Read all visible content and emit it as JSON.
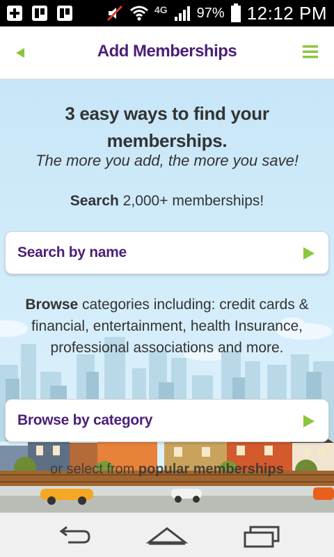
{
  "status_bar": {
    "network": "4G",
    "battery_percent": "97%",
    "time": "12:12 PM",
    "icons": [
      "add-widget-icon",
      "trello-icon",
      "trello-icon",
      "mute-icon",
      "wifi-icon",
      "lte-icon",
      "signal-icon",
      "battery-icon"
    ]
  },
  "header": {
    "title": "Add Memberships",
    "back_icon": "back-arrow-icon",
    "menu_icon": "hamburger-menu-icon"
  },
  "main": {
    "headline": "3 easy ways to find your memberships.",
    "subline": "The more you add, the more you save!",
    "search_prefix": "Search",
    "search_rest": " 2,000+ memberships!",
    "search_card_label": "Search by name",
    "browse_prefix": "Browse",
    "browse_rest": " categories including: credit cards & financial, entertainment, health Insurance, professional associations and more.",
    "browse_card_label": "Browse by category",
    "popular_prefix": "or select from ",
    "popular_bold": "popular memberships"
  },
  "nav_bar": {
    "icons": [
      "back-nav-icon",
      "home-nav-icon",
      "recent-apps-icon"
    ]
  },
  "colors": {
    "brand_purple": "#4c1f78",
    "accent_green": "#8cc63f",
    "sky": "#c7e6f8"
  }
}
